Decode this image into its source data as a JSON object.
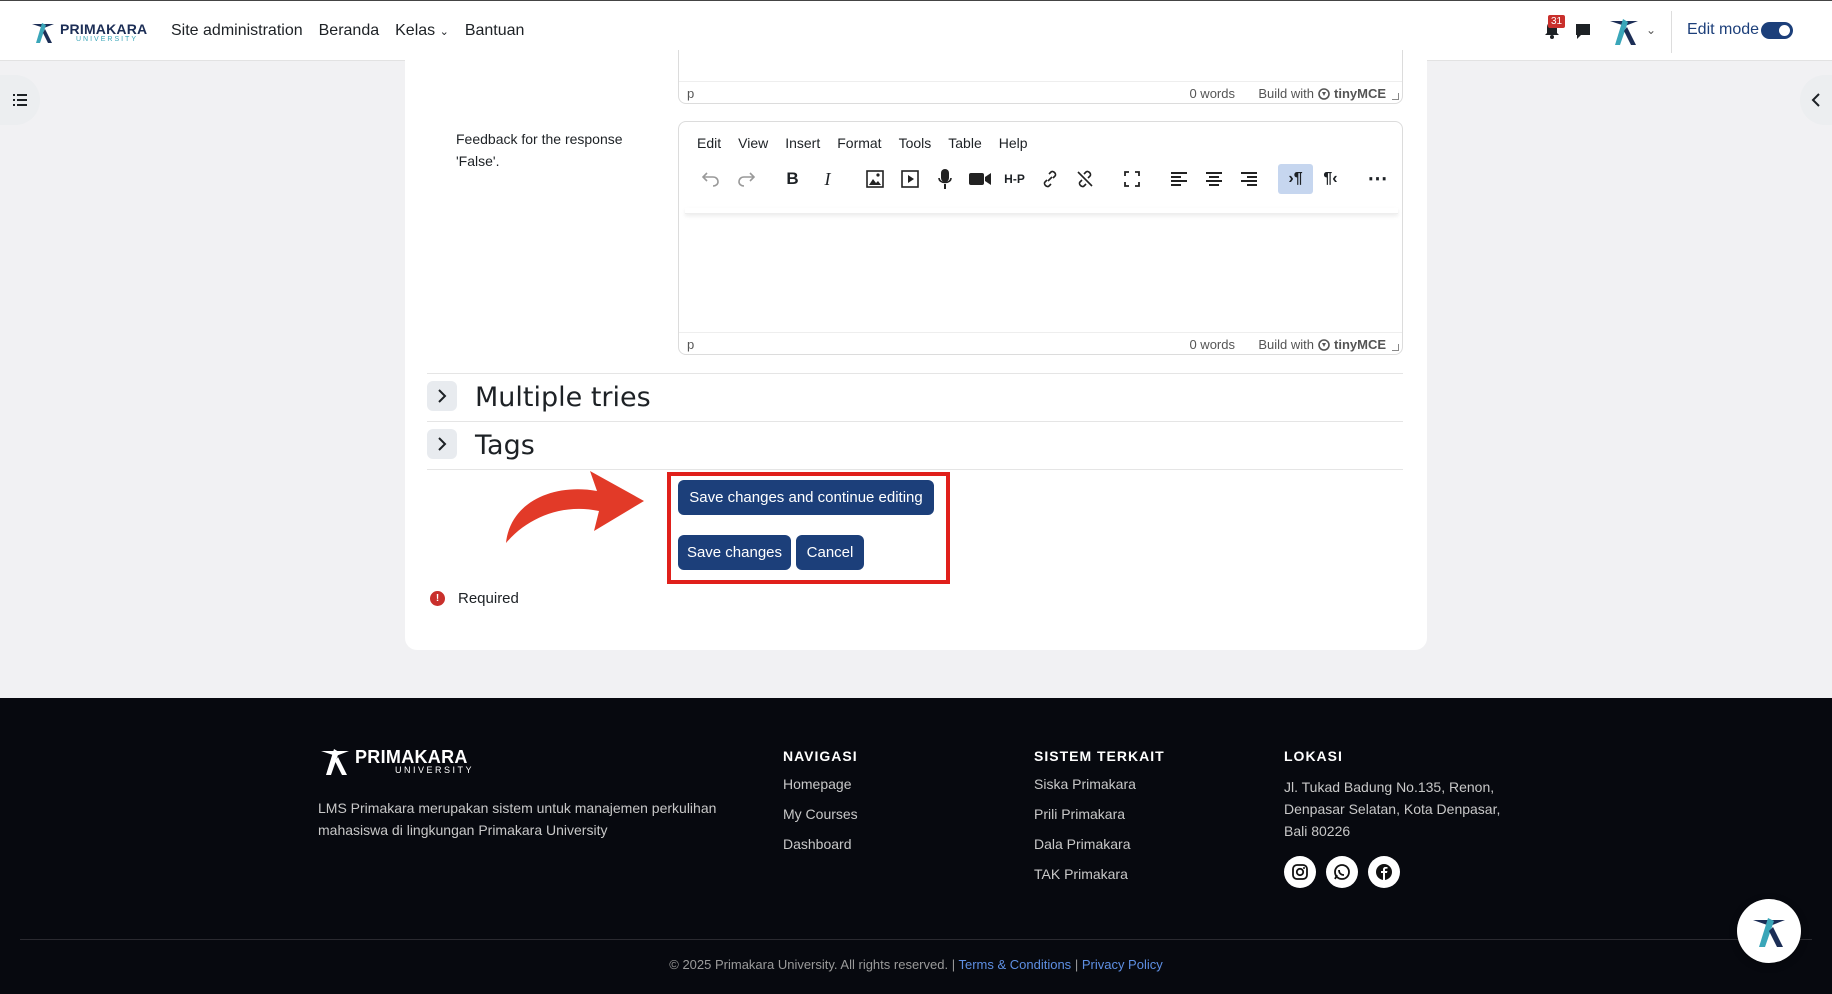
{
  "brand": {
    "name": "PRIMAKARA",
    "sub": "UNIVERSITY",
    "accent": "#1c3f7a",
    "teal": "#3aa6b9"
  },
  "nav": {
    "links": [
      "Site administration",
      "Beranda",
      "Kelas",
      "Bantuan"
    ],
    "notification_count": "31",
    "edit_mode_label": "Edit mode"
  },
  "editor_top": {
    "path": "p",
    "words": "0 words",
    "build": "Build with",
    "tiny": "tinyMCE"
  },
  "feedback": {
    "label": "Feedback for the response 'False'.",
    "menu": [
      "Edit",
      "View",
      "Insert",
      "Format",
      "Tools",
      "Table",
      "Help"
    ],
    "path": "p",
    "words": "0 words",
    "build": "Build with",
    "tiny": "tinyMCE"
  },
  "sections": {
    "multiple_tries": "Multiple tries",
    "tags": "Tags"
  },
  "buttons": {
    "save_continue": "Save changes and continue editing",
    "save": "Save changes",
    "cancel": "Cancel"
  },
  "required_label": "Required",
  "footer": {
    "brand": "PRIMAKARA",
    "brand_sub": "UNIVERSITY",
    "description": "LMS Primakara merupakan sistem untuk manajemen perkulihan mahasiswa di lingkungan Primakara University",
    "nav_head": "NAVIGASI",
    "nav_links": [
      "Homepage",
      "My Courses",
      "Dashboard"
    ],
    "sys_head": "SISTEM TERKAIT",
    "sys_links": [
      "Siska Primakara",
      "Prili Primakara",
      "Dala Primakara",
      "TAK Primakara"
    ],
    "loc_head": "LOKASI",
    "address": "Jl. Tukad Badung No.135, Renon, Denpasar Selatan, Kota Denpasar, Bali 80226",
    "copyright": "© 2025 Primakara University. All rights reserved. |",
    "terms": "Terms & Conditions",
    "sep": "|",
    "privacy": "Privacy Policy"
  }
}
